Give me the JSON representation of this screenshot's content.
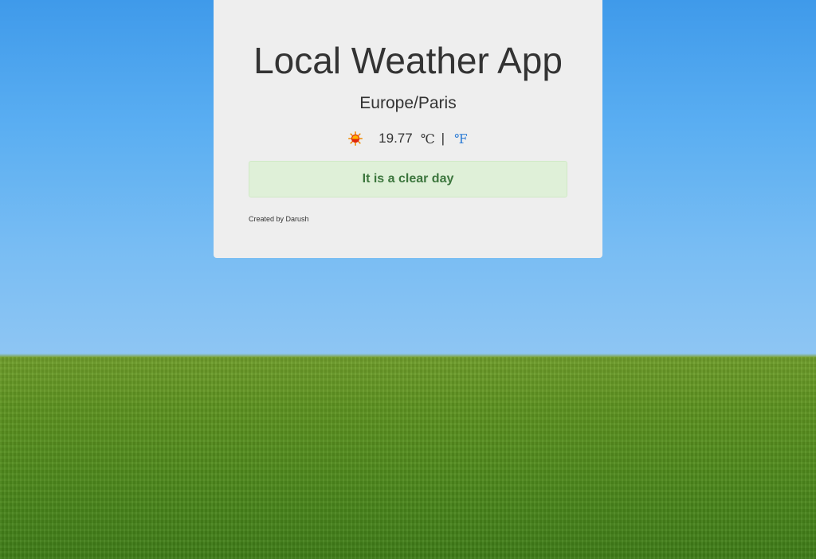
{
  "app": {
    "title": "Local Weather App",
    "location": "Europe/Paris"
  },
  "weather": {
    "icon": "sun-icon",
    "temperature": "19.77",
    "unit_celsius": "℃",
    "separator": "|",
    "unit_fahrenheit": "℉",
    "description": "It is a clear day"
  },
  "footer": {
    "credit": "Created by Darush"
  },
  "colors": {
    "card_bg": "#eeeeee",
    "alert_bg": "#dff0d8",
    "alert_text": "#3c763d",
    "link": "#2a7ad4"
  }
}
